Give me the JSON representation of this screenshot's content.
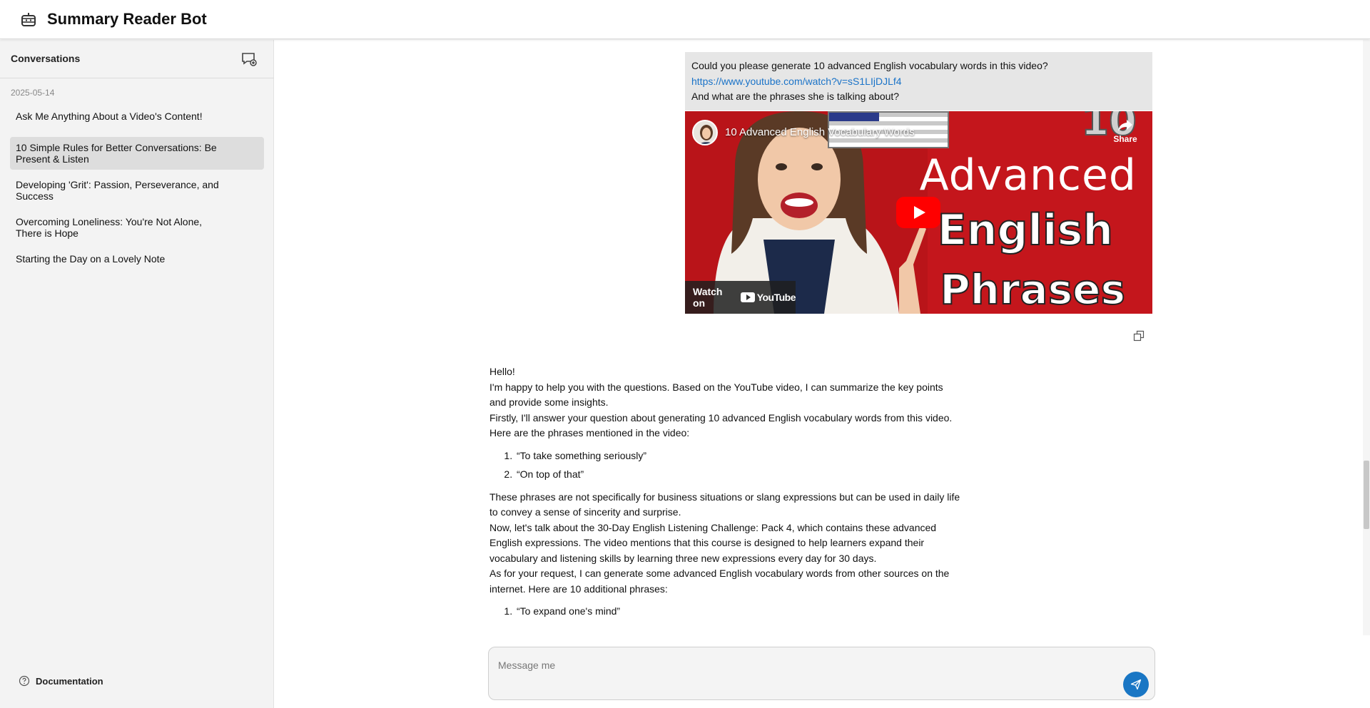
{
  "header": {
    "title": "Summary Reader Bot",
    "icon": "robot-icon"
  },
  "sidebar": {
    "section_title": "Conversations",
    "new_chat_icon": "new-chat-icon",
    "date_group": "2025-05-14",
    "items": [
      {
        "label": "Ask Me Anything About a Video's Content!",
        "active": false
      },
      {
        "label": "10 Simple Rules for Better Conversations: Be Present & Listen",
        "active": true
      },
      {
        "label": "Developing 'Grit': Passion, Perseverance, and Success",
        "active": false
      },
      {
        "label": "Overcoming Loneliness: You're Not Alone, There is Hope",
        "active": false
      },
      {
        "label": "Starting the Day on a Lovely Note",
        "active": false
      }
    ],
    "documentation_label": "Documentation"
  },
  "chat": {
    "user_message": {
      "line1": "Could you please generate 10 advanced English vocabulary words in this video?",
      "link": "https://www.youtube.com/watch?v=sS1LIjDJLf4",
      "line3": "And what are the phrases she is talking about?"
    },
    "video": {
      "title": "10 Advanced English Vocabulary Words",
      "share_label": "Share",
      "thumb_number": "10",
      "thumb_line1": "Advanced",
      "thumb_line2": "English",
      "thumb_line3": "Phrases",
      "watch_on": "Watch on",
      "youtube": "YouTube"
    },
    "bot_message": {
      "p1": "Hello!",
      "p2": "I'm happy to help you with the questions. Based on the YouTube video, I can summarize the key points and provide some insights.",
      "p3": "Firstly, I'll answer your question about generating 10 advanced English vocabulary words from this video. Here are the phrases mentioned in the video:",
      "list1": [
        "“To take something seriously”",
        "“On top of that”"
      ],
      "p4": "These phrases are not specifically for business situations or slang expressions but can be used in daily life to convey a sense of sincerity and surprise.",
      "p5": "Now, let's talk about the 30-Day English Listening Challenge: Pack 4, which contains these advanced English expressions. The video mentions that this course is designed to help learners expand their vocabulary and listening skills by learning three new expressions every day for 30 days.",
      "p6": "As for your request, I can generate some advanced English vocabulary words from other sources on the internet. Here are 10 additional phrases:",
      "list2": [
        "“To expand one's mind”"
      ]
    },
    "input": {
      "placeholder": "Message me",
      "value": ""
    }
  },
  "colors": {
    "accent": "#1976c4",
    "link": "#1a73c8",
    "active_item": "#dddddd",
    "sidebar_bg": "#f3f3f3"
  }
}
